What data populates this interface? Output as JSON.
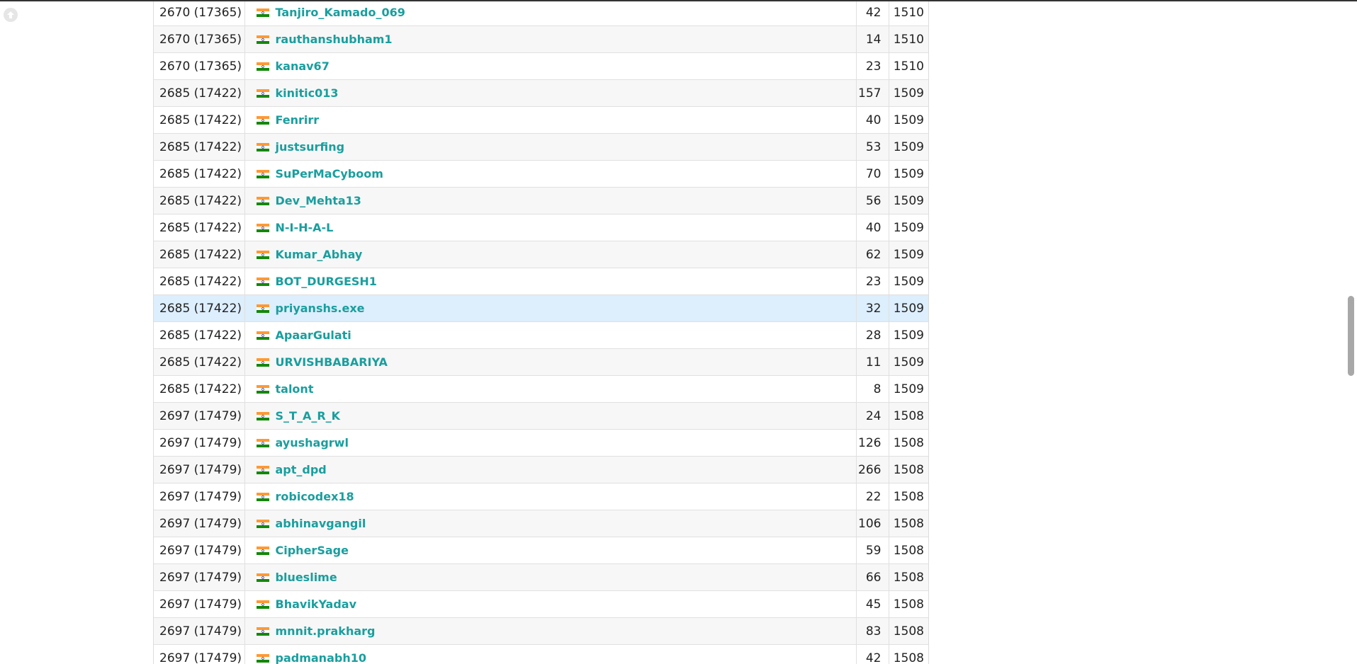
{
  "rows": [
    {
      "rank": "2670 (17365)",
      "handle": "Tanjiro_Kamado_069",
      "solved": "42",
      "rating": "1510"
    },
    {
      "rank": "2670 (17365)",
      "handle": "rauthanshubham1",
      "solved": "14",
      "rating": "1510"
    },
    {
      "rank": "2670 (17365)",
      "handle": "kanav67",
      "solved": "23",
      "rating": "1510"
    },
    {
      "rank": "2685 (17422)",
      "handle": "kinitic013",
      "solved": "157",
      "rating": "1509"
    },
    {
      "rank": "2685 (17422)",
      "handle": "Fenrirr",
      "solved": "40",
      "rating": "1509"
    },
    {
      "rank": "2685 (17422)",
      "handle": "justsurfing",
      "solved": "53",
      "rating": "1509"
    },
    {
      "rank": "2685 (17422)",
      "handle": "SuPerMaCyboom",
      "solved": "70",
      "rating": "1509"
    },
    {
      "rank": "2685 (17422)",
      "handle": "Dev_Mehta13",
      "solved": "56",
      "rating": "1509"
    },
    {
      "rank": "2685 (17422)",
      "handle": "N-I-H-A-L",
      "solved": "40",
      "rating": "1509"
    },
    {
      "rank": "2685 (17422)",
      "handle": "Kumar_Abhay",
      "solved": "62",
      "rating": "1509"
    },
    {
      "rank": "2685 (17422)",
      "handle": "BOT_DURGESH1",
      "solved": "23",
      "rating": "1509"
    },
    {
      "rank": "2685 (17422)",
      "handle": "priyanshs.exe",
      "solved": "32",
      "rating": "1509",
      "highlighted": true
    },
    {
      "rank": "2685 (17422)",
      "handle": "ApaarGulati",
      "solved": "28",
      "rating": "1509"
    },
    {
      "rank": "2685 (17422)",
      "handle": "URVISHBABARIYA",
      "solved": "11",
      "rating": "1509"
    },
    {
      "rank": "2685 (17422)",
      "handle": "talont",
      "solved": "8",
      "rating": "1509"
    },
    {
      "rank": "2697 (17479)",
      "handle": "S_T_A_R_K",
      "solved": "24",
      "rating": "1508"
    },
    {
      "rank": "2697 (17479)",
      "handle": "ayushagrwl",
      "solved": "126",
      "rating": "1508"
    },
    {
      "rank": "2697 (17479)",
      "handle": "apt_dpd",
      "solved": "266",
      "rating": "1508"
    },
    {
      "rank": "2697 (17479)",
      "handle": "robicodex18",
      "solved": "22",
      "rating": "1508"
    },
    {
      "rank": "2697 (17479)",
      "handle": "abhinavgangil",
      "solved": "106",
      "rating": "1508"
    },
    {
      "rank": "2697 (17479)",
      "handle": "CipherSage",
      "solved": "59",
      "rating": "1508"
    },
    {
      "rank": "2697 (17479)",
      "handle": "blueslime",
      "solved": "66",
      "rating": "1508"
    },
    {
      "rank": "2697 (17479)",
      "handle": "BhavikYadav",
      "solved": "45",
      "rating": "1508"
    },
    {
      "rank": "2697 (17479)",
      "handle": "mnnit.prakharg",
      "solved": "83",
      "rating": "1508"
    },
    {
      "rank": "2697 (17479)",
      "handle": "padmanabh10",
      "solved": "42",
      "rating": "1508"
    }
  ],
  "icons": {
    "flag": "india-flag-icon",
    "back_to_top": "arrow-up-circle-icon"
  },
  "colors": {
    "link": "#1a9e9e",
    "highlight_row": "#ddeefc",
    "flag_saffron": "#ff9933",
    "flag_green": "#138808",
    "flag_chakra": "#000080"
  },
  "scroll": {
    "position_fraction": 0.44
  }
}
